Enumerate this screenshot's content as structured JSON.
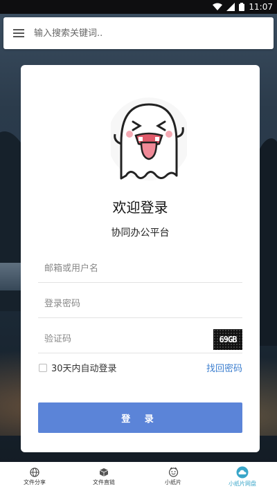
{
  "status_bar": {
    "time": "11:07",
    "icons": [
      "wifi-icon",
      "signal-icon",
      "battery-icon"
    ]
  },
  "search": {
    "placeholder": "输入搜索关键词.."
  },
  "login": {
    "title": "欢迎登录",
    "subtitle": "协同办公平台",
    "email_placeholder": "邮箱或用户名",
    "password_placeholder": "登录密码",
    "captcha_placeholder": "验证码",
    "captcha_text": "69GB",
    "remember_label": "30天内自动登录",
    "forgot_label": "找回密码",
    "submit_label": "登 录",
    "colors": {
      "button": "#5b84d8",
      "link": "#3d7fcf"
    }
  },
  "bottom_nav": {
    "items": [
      {
        "label": "文件分享",
        "icon": "globe-icon",
        "active": false
      },
      {
        "label": "文件直链",
        "icon": "cube-icon",
        "active": false
      },
      {
        "label": "小纸片",
        "icon": "smiley-icon",
        "active": false
      },
      {
        "label": "小纸片网盘",
        "icon": "cloud-icon",
        "active": true
      }
    ],
    "active_color": "#3aa6c9"
  }
}
